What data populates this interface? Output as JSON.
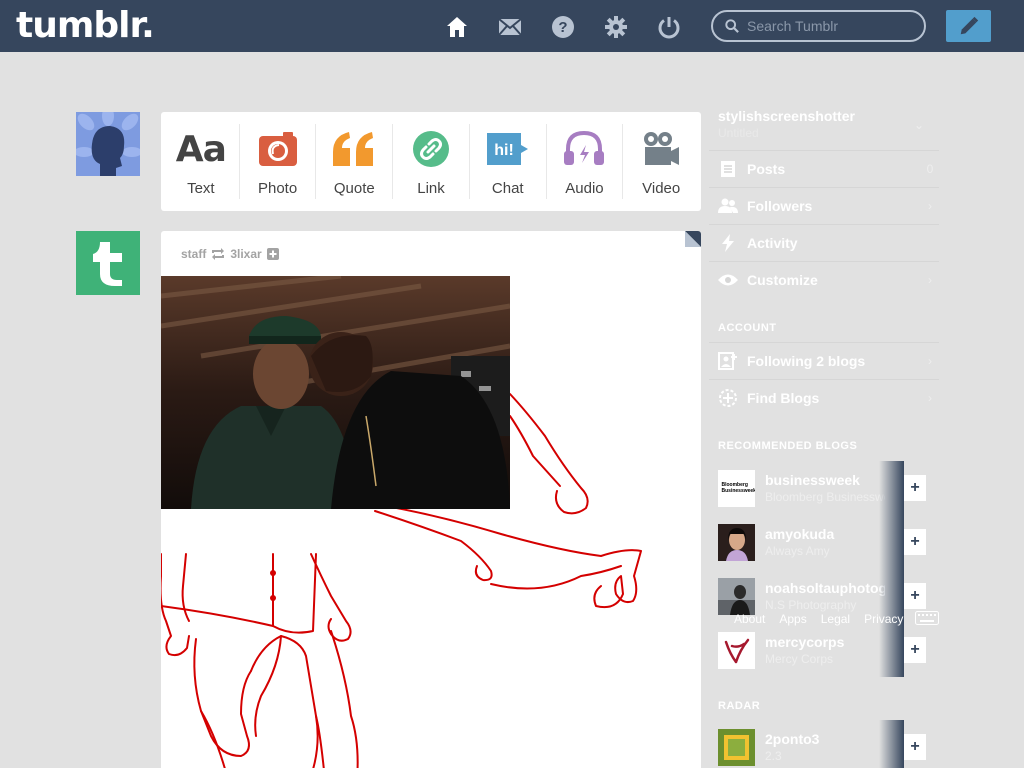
{
  "header": {
    "logo": "tumblr.",
    "search_placeholder": "Search Tumblr",
    "icons": [
      "home-icon",
      "mail-icon",
      "help-icon",
      "gear-icon",
      "power-icon"
    ],
    "colors": {
      "bar": "#36465d",
      "compose": "#529ecc"
    }
  },
  "post_types": [
    {
      "label": "Text",
      "icon": "text-icon",
      "glyph": "Aa",
      "color": "#444444"
    },
    {
      "label": "Photo",
      "icon": "camera-icon",
      "color": "#d95e40"
    },
    {
      "label": "Quote",
      "icon": "quote-icon",
      "glyph": "““",
      "color": "#f2992e"
    },
    {
      "label": "Link",
      "icon": "link-icon",
      "color": "#56bc8a"
    },
    {
      "label": "Chat",
      "icon": "chat-icon",
      "glyph": "hi!",
      "color": "#529ecc"
    },
    {
      "label": "Audio",
      "icon": "headphones-icon",
      "color": "#a77dc2"
    },
    {
      "label": "Video",
      "icon": "video-camera-icon",
      "color": "#748089"
    }
  ],
  "post": {
    "author": "staff",
    "reblogged_from": "3lixar"
  },
  "sidebar": {
    "blog_name": "stylishscreenshotter",
    "blog_subtitle": "Untitled",
    "menu": [
      {
        "label": "Posts",
        "right": "0",
        "icon": "posts-icon"
      },
      {
        "label": "Followers",
        "right": "›",
        "icon": "followers-icon"
      },
      {
        "label": "Activity",
        "right": "",
        "icon": "activity-icon"
      },
      {
        "label": "Customize",
        "right": "›",
        "icon": "eye-icon"
      }
    ],
    "account_heading": "ACCOUNT",
    "account": [
      {
        "label": "Following 2 blogs",
        "right": "›",
        "icon": "following-icon"
      },
      {
        "label": "Find Blogs",
        "right": "›",
        "icon": "compass-icon"
      }
    ],
    "recommended_heading": "RECOMMENDED BLOGS",
    "recommended": [
      {
        "name": "businessweek",
        "subtitle": "Bloomberg Businessweek",
        "avatar_text": "Bloomberg Businessweek"
      },
      {
        "name": "amyokuda",
        "subtitle": "Always Amy",
        "avatar_text": ""
      },
      {
        "name": "noahsoltauphotography",
        "subtitle": "N.S Photography",
        "avatar_text": ""
      },
      {
        "name": "mercycorps",
        "subtitle": "Mercy Corps",
        "avatar_text": ""
      }
    ],
    "footer_links": [
      "About",
      "Apps",
      "Legal",
      "Privacy"
    ],
    "radar_heading": "RADAR",
    "radar": {
      "name": "2ponto3",
      "subtitle": "2.3"
    }
  }
}
